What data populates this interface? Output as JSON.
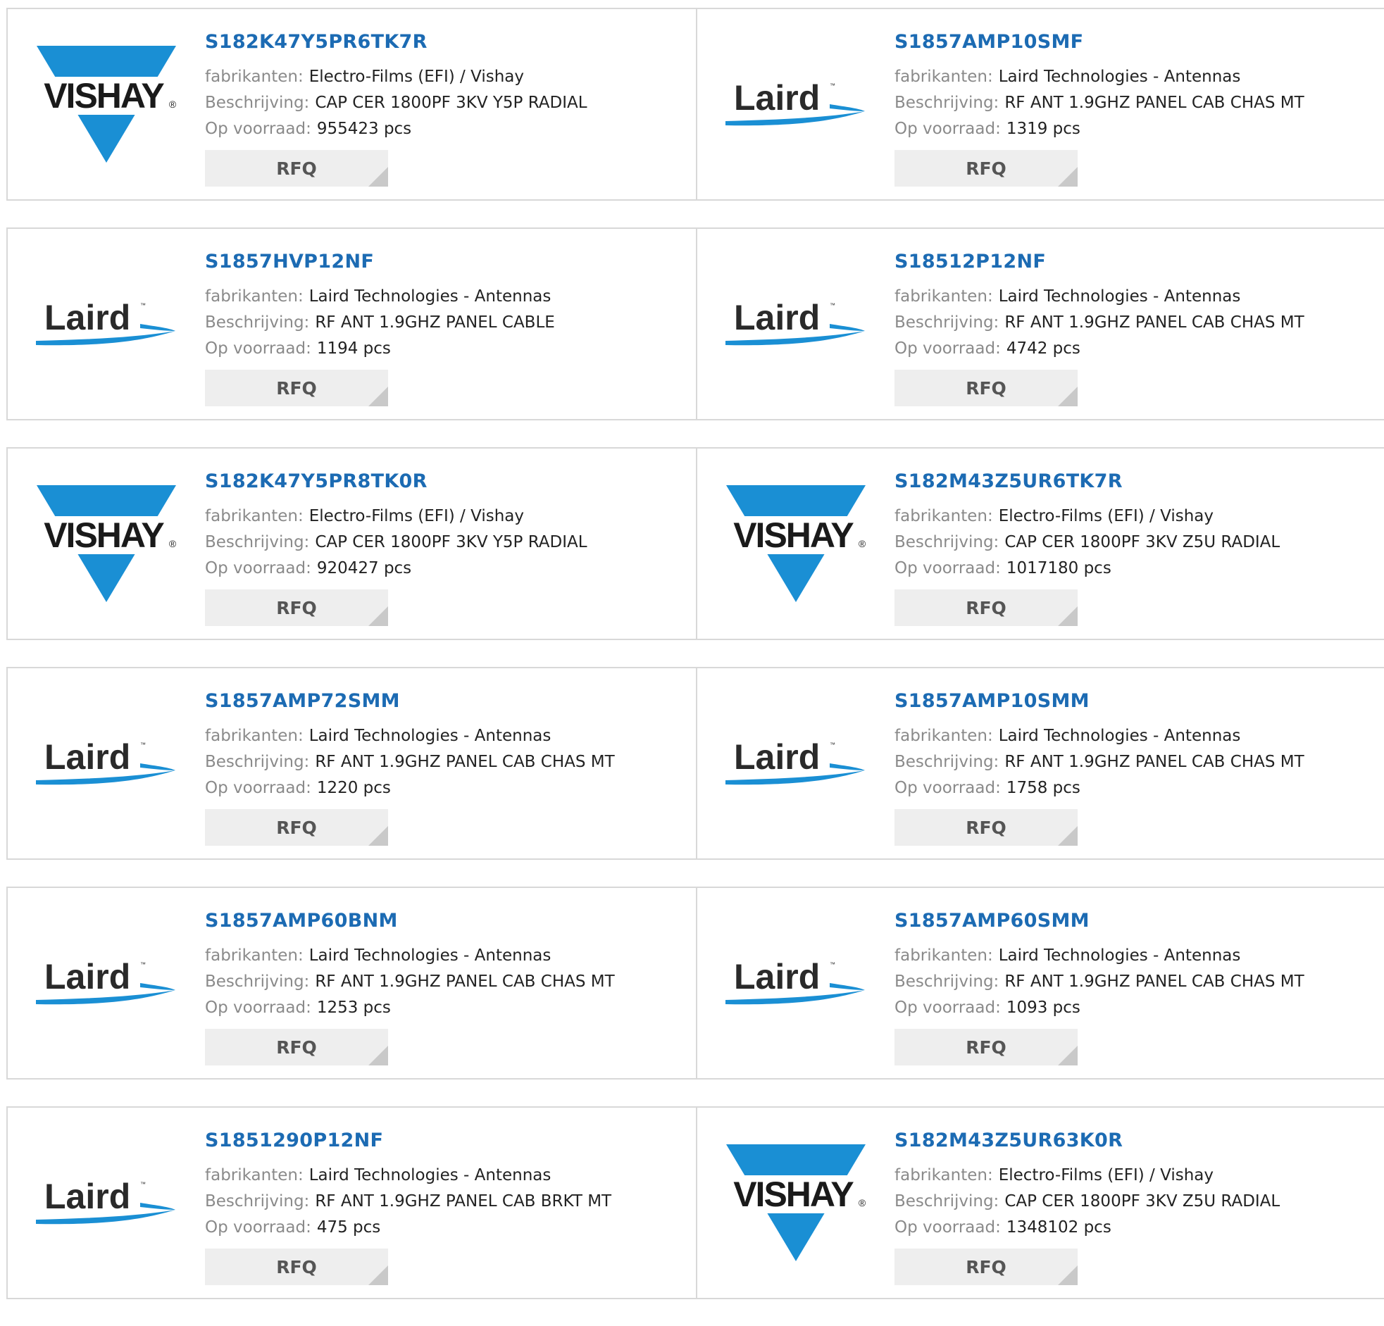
{
  "labels": {
    "manufacturer": "fabrikanten:",
    "description": "Beschrijving:",
    "stock": "Op voorraad:",
    "rfq": "RFQ"
  },
  "colors": {
    "title": "#1c6bb3",
    "vishay_blue": "#1a8fd4",
    "laird_blue": "#1a8fd4",
    "border": "#d8d8d8",
    "button_bg": "#eeeeee"
  },
  "logos": {
    "vishay": {
      "text": "VISHAY",
      "mark": "®"
    },
    "laird": {
      "text": "Laird",
      "mark": "™"
    }
  },
  "products": [
    {
      "part": "S182K47Y5PR6TK7R",
      "logo": "vishay",
      "manufacturer": "Electro-Films (EFI) / Vishay",
      "description": "CAP CER 1800PF 3KV Y5P RADIAL",
      "stock": "955423 pcs"
    },
    {
      "part": "S1857AMP10SMF",
      "logo": "laird",
      "manufacturer": "Laird Technologies - Antennas",
      "description": "RF ANT 1.9GHZ PANEL CAB CHAS MT",
      "stock": "1319 pcs"
    },
    {
      "part": "S1857HVP12NF",
      "logo": "laird",
      "manufacturer": "Laird Technologies - Antennas",
      "description": "RF ANT 1.9GHZ PANEL CABLE",
      "stock": "1194 pcs"
    },
    {
      "part": "S18512P12NF",
      "logo": "laird",
      "manufacturer": "Laird Technologies - Antennas",
      "description": "RF ANT 1.9GHZ PANEL CAB CHAS MT",
      "stock": "4742 pcs"
    },
    {
      "part": "S182K47Y5PR8TK0R",
      "logo": "vishay",
      "manufacturer": "Electro-Films (EFI) / Vishay",
      "description": "CAP CER 1800PF 3KV Y5P RADIAL",
      "stock": "920427 pcs"
    },
    {
      "part": "S182M43Z5UR6TK7R",
      "logo": "vishay",
      "manufacturer": "Electro-Films (EFI) / Vishay",
      "description": "CAP CER 1800PF 3KV Z5U RADIAL",
      "stock": "1017180 pcs"
    },
    {
      "part": "S1857AMP72SMM",
      "logo": "laird",
      "manufacturer": "Laird Technologies - Antennas",
      "description": "RF ANT 1.9GHZ PANEL CAB CHAS MT",
      "stock": "1220 pcs"
    },
    {
      "part": "S1857AMP10SMM",
      "logo": "laird",
      "manufacturer": "Laird Technologies - Antennas",
      "description": "RF ANT 1.9GHZ PANEL CAB CHAS MT",
      "stock": "1758 pcs"
    },
    {
      "part": "S1857AMP60BNM",
      "logo": "laird",
      "manufacturer": "Laird Technologies - Antennas",
      "description": "RF ANT 1.9GHZ PANEL CAB CHAS MT",
      "stock": "1253 pcs"
    },
    {
      "part": "S1857AMP60SMM",
      "logo": "laird",
      "manufacturer": "Laird Technologies - Antennas",
      "description": "RF ANT 1.9GHZ PANEL CAB CHAS MT",
      "stock": "1093 pcs"
    },
    {
      "part": "S1851290P12NF",
      "logo": "laird",
      "manufacturer": "Laird Technologies - Antennas",
      "description": "RF ANT 1.9GHZ PANEL CAB BRKT MT",
      "stock": "475 pcs"
    },
    {
      "part": "S182M43Z5UR63K0R",
      "logo": "vishay",
      "manufacturer": "Electro-Films (EFI) / Vishay",
      "description": "CAP CER 1800PF 3KV Z5U RADIAL",
      "stock": "1348102 pcs"
    }
  ]
}
